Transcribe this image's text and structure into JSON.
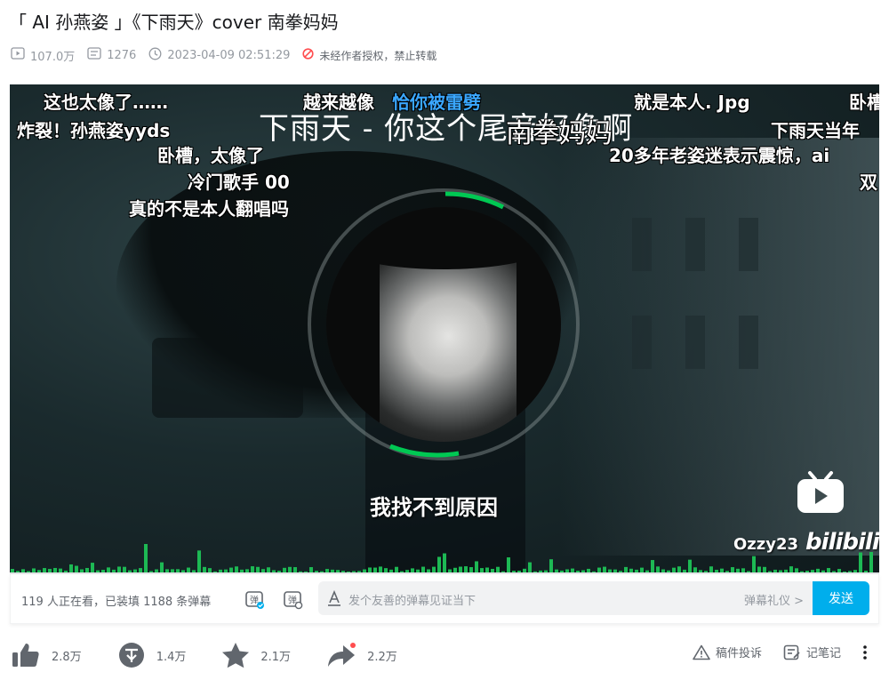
{
  "title": "「 AI 孙燕姿 」《下雨天》cover 南拳妈妈",
  "meta": {
    "views": "107.0万",
    "danmaku_count": "1276",
    "date": "2023-04-09 02:51:29",
    "copyright": "未经作者授权，禁止转载"
  },
  "player": {
    "cover_title": "下雨天 - 你这个尾音好像啊",
    "lyric": "我找不到原因",
    "watermark_user": "Ozzy23",
    "watermark_brand": "bilibili",
    "danmaku": [
      {
        "text": "这也太像了……",
        "color": "white"
      },
      {
        "text": "越来越像",
        "color": "white"
      },
      {
        "text": "恰你被雷劈",
        "color": "blue"
      },
      {
        "text": "南拳妈妈",
        "color": "white"
      },
      {
        "text": "就是本人. Jpg",
        "color": "white"
      },
      {
        "text": "卧槽",
        "color": "white"
      },
      {
        "text": "炸裂！孙燕姿yyds",
        "color": "white"
      },
      {
        "text": "下雨天当年",
        "color": "white"
      },
      {
        "text": "卧槽，太像了",
        "color": "white"
      },
      {
        "text": "20多年老姿迷表示震惊，ai",
        "color": "white"
      },
      {
        "text": "冷门歌手 00",
        "color": "white"
      },
      {
        "text": "双",
        "color": "white"
      },
      {
        "text": "真的不是本人翻唱吗",
        "color": "white"
      }
    ]
  },
  "toolbar": {
    "viewers": "119 人正在看，已装填 1188 条弹幕",
    "input_placeholder": "发个友善的弹幕见证当下",
    "etiquette": "弹幕礼仪 >",
    "send": "发送"
  },
  "actions": {
    "like": "2.8万",
    "coin": "1.4万",
    "favorite": "2.1万",
    "share": "2.2万",
    "report": "稿件投诉",
    "notes": "记笔记"
  },
  "colors": {
    "accent": "#00aeec",
    "progress": "#00c853",
    "danmaku_blue": "#3aa7ff",
    "warn_red": "#ff4d4f"
  }
}
